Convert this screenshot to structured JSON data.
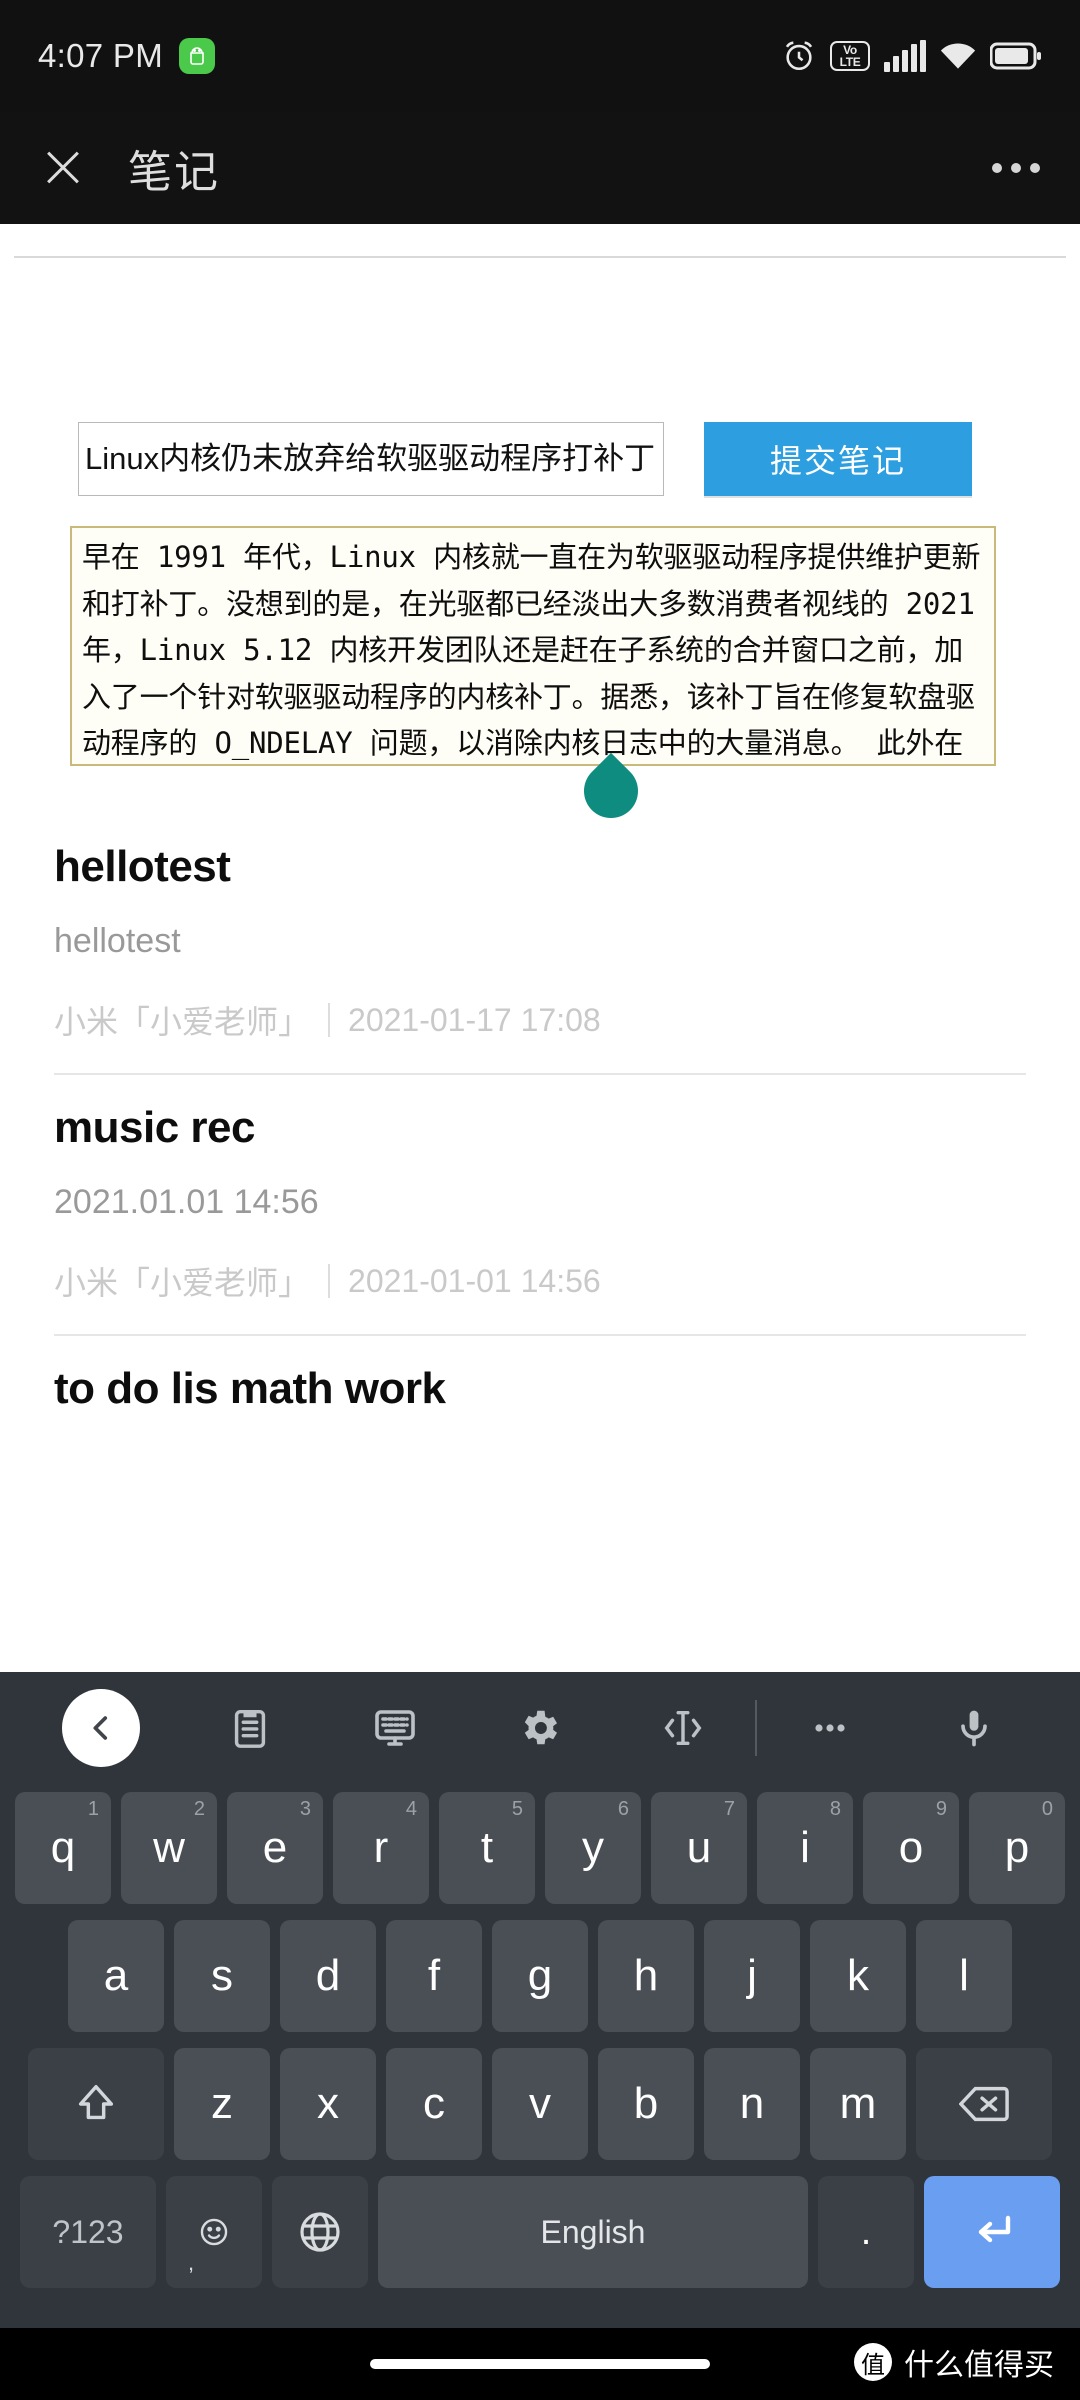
{
  "status_bar": {
    "time": "4:07 PM",
    "app_badge_icon": "android-robot-icon",
    "alarm_icon": "alarm-clock-icon",
    "volte_top": "Vo",
    "volte_bottom": "LTE",
    "signal_icon": "signal-bars-icon",
    "wifi_icon": "wifi-icon",
    "battery_icon": "battery-icon",
    "badge_color": "#4bc94b"
  },
  "app_bar": {
    "close_label": "×",
    "title": "笔记",
    "overflow_label": "···"
  },
  "form": {
    "input_value": "Linux内核仍未放弃给软驱驱动程序打补丁",
    "input_placeholder": "",
    "submit_label": "提交笔记",
    "submit_color": "#2d9fe0",
    "textarea_value": "早在 1991 年代，Linux 内核就一直在为软驱驱动程序提供维护更新和打补丁。没想到的是，在光驱都已经淡出大多数消费者视线的 2021 年，Linux 5.12 内核开发团队还是赶在子系统的合并窗口之前，加入了一个针对软驱驱动程序的内核补丁。据悉，该补丁旨在修复软盘驱动程序的 O_NDELAY 问题，以消除内核日志中的大量消息。\n此外在 O_NONBLOCK 打开一次之后，软盘驱动可能会加载失"
  },
  "notes": [
    {
      "title": "hellotest",
      "body": "hellotest",
      "source": "小米「小爱老师」",
      "timestamp": "2021-01-17 17:08"
    },
    {
      "title": "music rec",
      "body": "2021.01.01 14:56",
      "source": "小米「小爱老师」",
      "timestamp": "2021-01-01 14:56"
    },
    {
      "title": "to do lis math work",
      "body": "",
      "source": "",
      "timestamp": ""
    }
  ],
  "keyboard": {
    "toolbar": [
      {
        "name": "back-chevron-icon",
        "label": "‹"
      },
      {
        "name": "clipboard-icon",
        "label": "clipboard"
      },
      {
        "name": "keyboard-layout-icon",
        "label": "keyboard"
      },
      {
        "name": "gear-icon",
        "label": "settings"
      },
      {
        "name": "cursor-move-icon",
        "label": "cursor"
      },
      {
        "name": "more-dots-icon",
        "label": "···"
      },
      {
        "name": "microphone-icon",
        "label": "mic"
      }
    ],
    "row1": [
      {
        "key": "q",
        "sup": "1"
      },
      {
        "key": "w",
        "sup": "2"
      },
      {
        "key": "e",
        "sup": "3"
      },
      {
        "key": "r",
        "sup": "4"
      },
      {
        "key": "t",
        "sup": "5"
      },
      {
        "key": "y",
        "sup": "6"
      },
      {
        "key": "u",
        "sup": "7"
      },
      {
        "key": "i",
        "sup": "8"
      },
      {
        "key": "o",
        "sup": "9"
      },
      {
        "key": "p",
        "sup": "0"
      }
    ],
    "row2": [
      {
        "key": "a"
      },
      {
        "key": "s"
      },
      {
        "key": "d"
      },
      {
        "key": "f"
      },
      {
        "key": "g"
      },
      {
        "key": "h"
      },
      {
        "key": "j"
      },
      {
        "key": "k"
      },
      {
        "key": "l"
      }
    ],
    "row3": [
      {
        "key": "z"
      },
      {
        "key": "x"
      },
      {
        "key": "c"
      },
      {
        "key": "v"
      },
      {
        "key": "b"
      },
      {
        "key": "n"
      },
      {
        "key": "m"
      }
    ],
    "shift_label": "⇧",
    "backspace_label": "⌫",
    "symbols_label": "?123",
    "emoji_label": "☺",
    "emoji_sub_label": ",",
    "globe_label": "globe-icon",
    "space_label": "English",
    "period_label": ".",
    "enter_label": "↵",
    "enter_color": "#6a9ef0"
  },
  "nav": {
    "home_pill": "home-indicator",
    "watermark_badge": "值",
    "watermark_text": "什么值得买"
  }
}
